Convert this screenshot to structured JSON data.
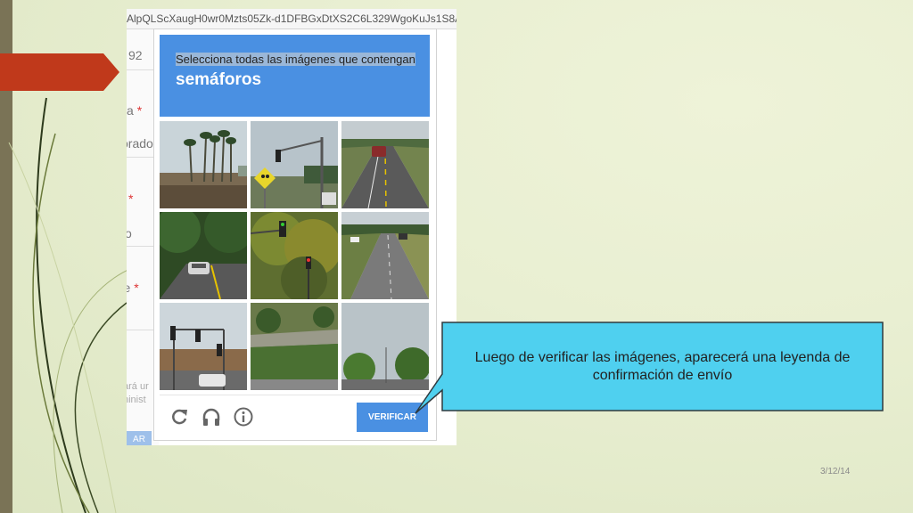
{
  "browser": {
    "url_text": "AlpQLScXaugH0wr0Mzts05Zk-d1DFBGxDtXS2C6L329WgoKuJs1S8A/viewfo"
  },
  "background_form": {
    "frag_1": "92",
    "frag_2": "a",
    "frag_3": "orado",
    "frag_5": "o",
    "frag_6": "rte",
    "frag_7": "ará ur",
    "frag_8": "ninist",
    "button_label": "AR",
    "required_mark": "*"
  },
  "captcha": {
    "instruction_highlight_prefix": "Se",
    "instruction_rest": "lecciona todas las imágenes que contengan",
    "object": "semáforos",
    "tiles": [
      {
        "scene": "palm-trees"
      },
      {
        "scene": "school-crossing-sign-traffic-light"
      },
      {
        "scene": "highway-car"
      },
      {
        "scene": "wooded-road-car"
      },
      {
        "scene": "tree-traffic-light"
      },
      {
        "scene": "road-with-cars"
      },
      {
        "scene": "intersection-traffic-lights"
      },
      {
        "scene": "grass-hill"
      },
      {
        "scene": "trees-road"
      }
    ],
    "footer": {
      "reload_icon": "reload-icon",
      "audio_icon": "headphones-icon",
      "info_icon": "info-icon",
      "verify_label": "VERIFICAR"
    }
  },
  "callout": {
    "text": "Luego de verificar las imágenes, aparecerá una leyenda de confirmación de envío",
    "fill": "#4fd0ef"
  },
  "slide": {
    "date": "3/12/14",
    "accent": "#c0391b"
  }
}
